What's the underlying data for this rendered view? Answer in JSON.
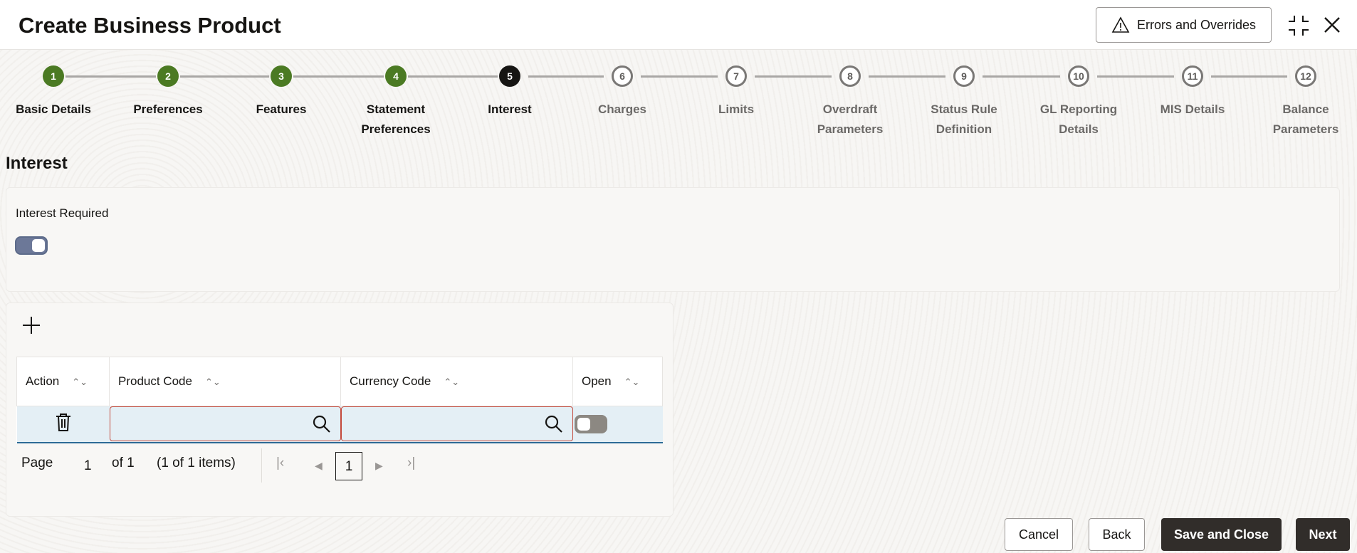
{
  "header": {
    "title": "Create Business Product",
    "errors_label": "Errors and Overrides"
  },
  "steps": [
    {
      "num": "1",
      "label": "Basic Details",
      "state": "done"
    },
    {
      "num": "2",
      "label": "Preferences",
      "state": "done"
    },
    {
      "num": "3",
      "label": "Features",
      "state": "done"
    },
    {
      "num": "4",
      "label": "Statement Preferences",
      "state": "done"
    },
    {
      "num": "5",
      "label": "Interest",
      "state": "current"
    },
    {
      "num": "6",
      "label": "Charges",
      "state": "todo"
    },
    {
      "num": "7",
      "label": "Limits",
      "state": "todo"
    },
    {
      "num": "8",
      "label": "Overdraft Parameters",
      "state": "todo"
    },
    {
      "num": "9",
      "label": "Status Rule Definition",
      "state": "todo"
    },
    {
      "num": "10",
      "label": "GL Reporting Details",
      "state": "todo"
    },
    {
      "num": "11",
      "label": "MIS Details",
      "state": "todo"
    },
    {
      "num": "12",
      "label": "Balance Parameters",
      "state": "todo"
    }
  ],
  "section": {
    "title": "Interest",
    "interest_required_label": "Interest Required",
    "interest_required": true
  },
  "table": {
    "columns": [
      "Action",
      "Product Code",
      "Currency Code",
      "Open"
    ],
    "rows": [
      {
        "product_code": "",
        "currency_code": "",
        "open": false
      }
    ]
  },
  "pagination": {
    "page_label": "Page",
    "page": "1",
    "of_label": "of 1",
    "items": "(1 of 1 items)",
    "current": "1"
  },
  "footer": {
    "cancel": "Cancel",
    "back": "Back",
    "save_close": "Save and Close",
    "next": "Next"
  }
}
